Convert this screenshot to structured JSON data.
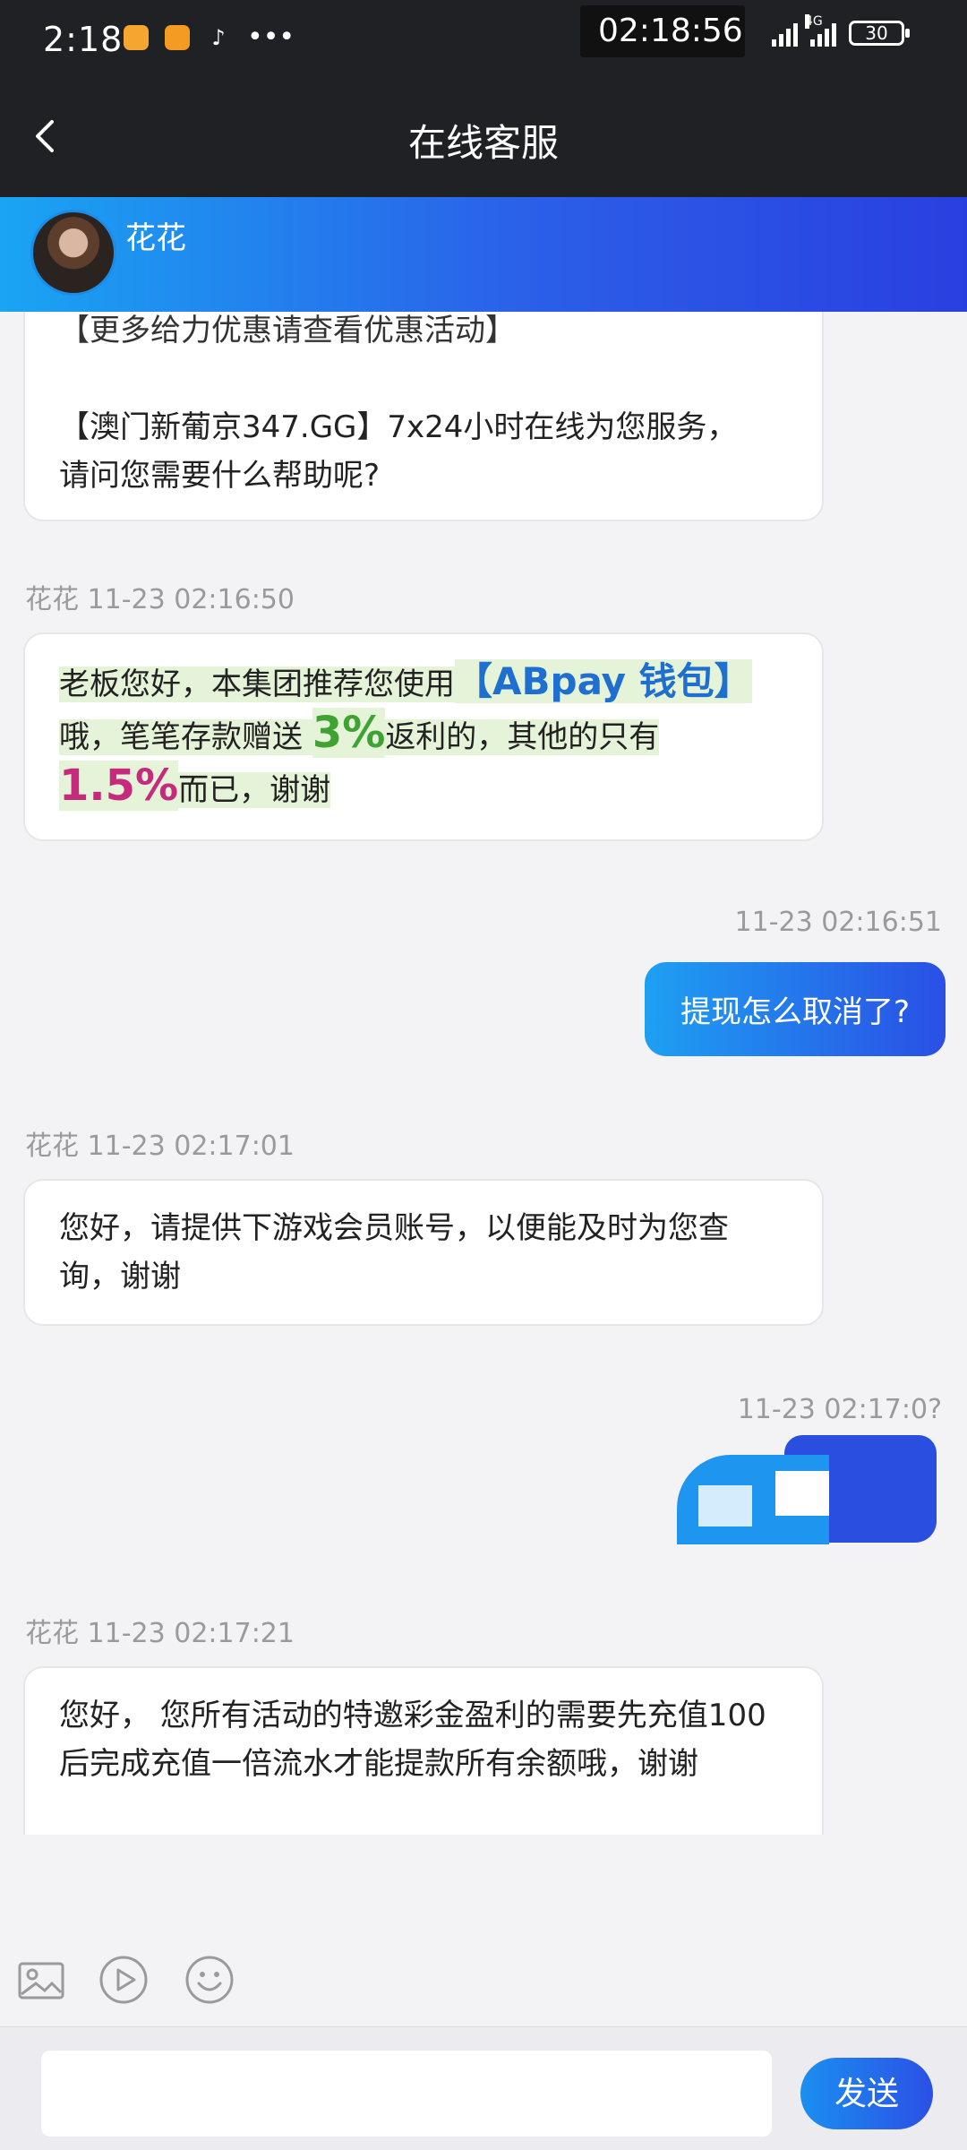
{
  "status_bar": {
    "time": "2:18",
    "overlay_clock": "02:18:56",
    "network": "4G",
    "battery": "30"
  },
  "header": {
    "title": "在线客服"
  },
  "agent": {
    "name": "花花"
  },
  "messages": [
    {
      "side": "left",
      "lines": [
        "【更多给力优惠请查看优惠活动】",
        "",
        "【澳门新葡京347.GG】7x24小时在线为您服务，",
        "请问您需要什么帮助呢?"
      ]
    },
    {
      "side": "left",
      "timestamp": "花花 11-23 02:16:50",
      "parts": {
        "a": "老板您好，本集团推荐您使用",
        "b": "【ABpay 钱包】",
        "c": "哦，笔笔存款赠送 ",
        "d": "3%",
        "e": "返利的，其他的只有",
        "f": "1.5%",
        "g": "而已，谢谢"
      }
    },
    {
      "side": "right",
      "timestamp": "11-23 02:16:51",
      "text": "提现怎么取消了?"
    },
    {
      "side": "left",
      "timestamp": "花花 11-23 02:17:01",
      "text": "您好，请提供下游戏会员账号，以便能及时为您查询，谢谢"
    },
    {
      "side": "right",
      "timestamp": "11-23 02:17:0?"
    },
    {
      "side": "left",
      "timestamp": "花花 11-23 02:17:21",
      "text": "您好， 您所有活动的特邀彩金盈利的需要先充值100后完成充值一倍流水才能提款所有余额哦，谢谢"
    }
  ],
  "input": {
    "placeholder": "",
    "send_label": "发送"
  },
  "icons": {
    "back": "chevron-left-icon",
    "image": "image-icon",
    "video": "play-circle-icon",
    "emoji": "smiley-icon"
  },
  "colors": {
    "header_bg": "#202124",
    "accent_start": "#1aa4f3",
    "accent_end": "#2a3fe0",
    "highlight": "#e5f3d8",
    "blue_text": "#1e6fd0",
    "green_text": "#3fa334",
    "pink_text": "#c62a7c"
  }
}
